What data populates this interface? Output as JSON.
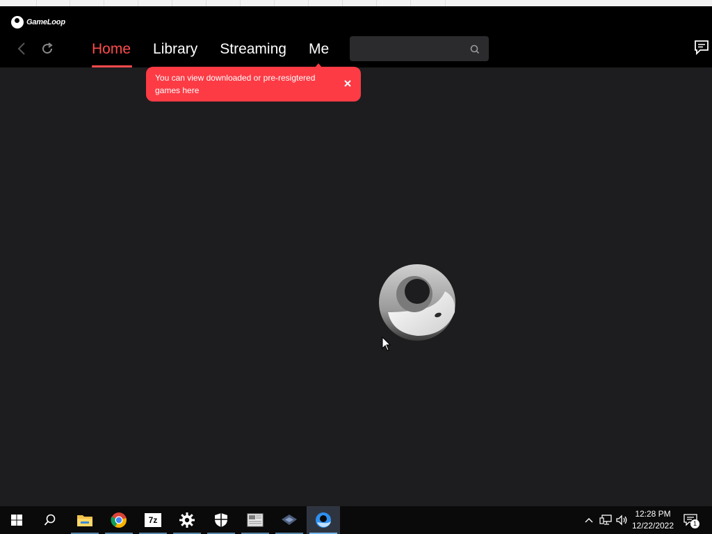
{
  "app": {
    "brand_name": "GameLoop",
    "tabs": [
      {
        "label": "Home",
        "active": true
      },
      {
        "label": "Library",
        "active": false
      },
      {
        "label": "Streaming",
        "active": false
      },
      {
        "label": "Me",
        "active": false
      }
    ],
    "search": {
      "placeholder": "",
      "value": ""
    },
    "tooltip": {
      "text": "You can view downloaded or pre-resigtered games here"
    },
    "icons": {
      "back": "back-arrow-icon",
      "refresh": "refresh-icon",
      "search": "search-icon",
      "messages": "message-icon",
      "close": "close-icon",
      "loading": "gameloop-logo-icon"
    },
    "colors": {
      "accent": "#ff4b4b",
      "tooltip_bg": "#fc3b45",
      "background": "#1d1d1f",
      "header": "#000000"
    }
  },
  "taskbar": {
    "items": [
      {
        "name": "start-button",
        "icon": "windows-logo-icon"
      },
      {
        "name": "search-button",
        "icon": "search-icon"
      },
      {
        "name": "file-explorer",
        "icon": "folder-icon"
      },
      {
        "name": "chrome",
        "icon": "chrome-icon"
      },
      {
        "name": "7zip",
        "icon": "7zip-icon",
        "label": "7z"
      },
      {
        "name": "settings",
        "icon": "gear-icon"
      },
      {
        "name": "windows-security",
        "icon": "shield-icon"
      },
      {
        "name": "image-viewer",
        "icon": "image-icon"
      },
      {
        "name": "virtualbox",
        "icon": "box-icon"
      },
      {
        "name": "gameloop",
        "icon": "gameloop-icon"
      }
    ],
    "tray": {
      "time": "12:28 PM",
      "date": "12/22/2022",
      "notification_count": "1"
    }
  }
}
